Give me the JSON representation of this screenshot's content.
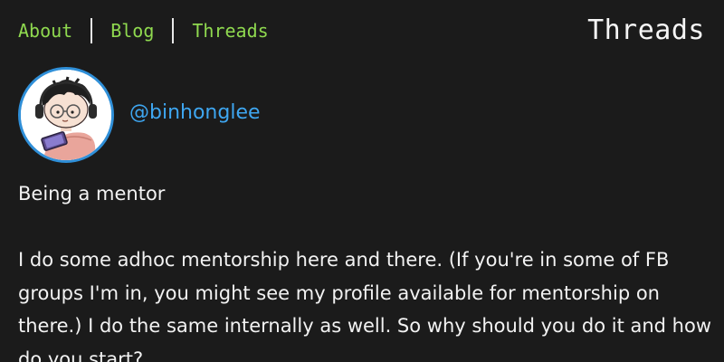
{
  "nav": {
    "items": [
      {
        "label": "About"
      },
      {
        "label": "Blog"
      },
      {
        "label": "Threads"
      }
    ]
  },
  "page": {
    "heading": "Threads"
  },
  "profile": {
    "username": "@binhonglee",
    "avatar": {
      "icon": "avatar-illustration",
      "border_color": "#2f8fd8"
    }
  },
  "post": {
    "title": "Being a mentor",
    "body": "I do some adhoc mentorship here and there. (If you're in some of FB groups I'm in, you might see my profile available for mentorship on there.) I do the same internally as well. So why should you do it and how do you start?"
  },
  "colors": {
    "background": "#1b1b1b",
    "nav_link": "#8fd94f",
    "username_link": "#3ea6f0",
    "text": "#f2f2f2"
  }
}
